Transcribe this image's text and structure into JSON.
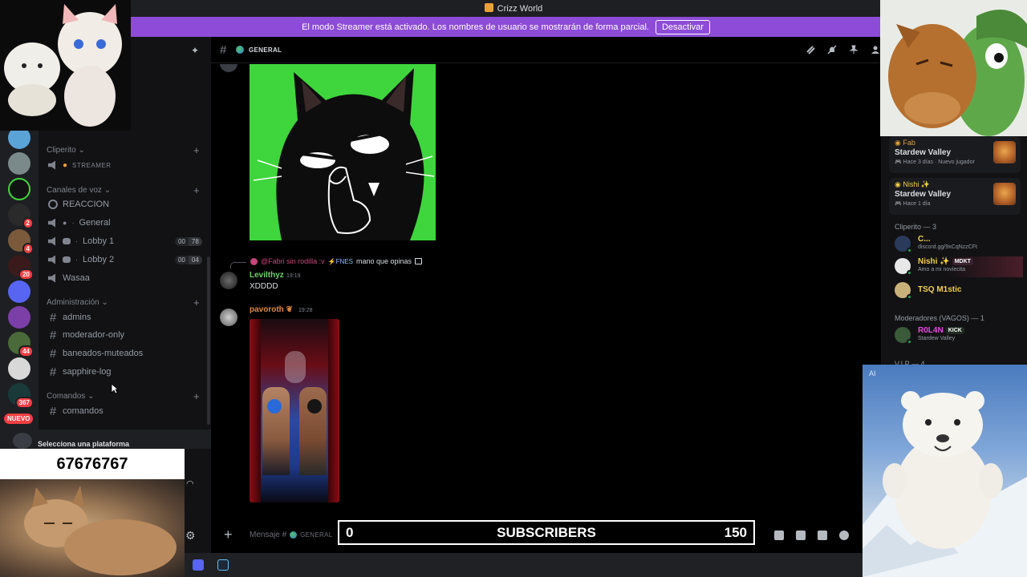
{
  "window": {
    "title": "Crizz World"
  },
  "banner": {
    "text": "El modo Streamer está activado. Los nombres de usuario se mostrarán de forma parcial.",
    "button": "Desactivar"
  },
  "guilds": {
    "badges": [
      "2",
      "4",
      "20",
      "44",
      "367"
    ],
    "new_label": "NUEVO"
  },
  "sidebar": {
    "categories": {
      "cliperito": "Cliperito",
      "voz": "Canales de voz",
      "admin": "Administración",
      "comandos": "Comandos"
    },
    "cliperito_channel": "STREAMER",
    "voice": [
      {
        "name": "REACCION"
      },
      {
        "name": "General"
      },
      {
        "name": "Lobby 1",
        "c1": "00",
        "c2": "78"
      },
      {
        "name": "Lobby 2",
        "c1": "00",
        "c2": "04"
      },
      {
        "name": "Wasaa"
      }
    ],
    "admin": [
      "admins",
      "moderador-only",
      "baneados-muteados",
      "sapphire-log"
    ],
    "comandos": [
      "comandos"
    ],
    "user_panel": "Selecciona una plataforma"
  },
  "chat": {
    "channel_name": "GENERAL",
    "reply": {
      "name": "@Fabri sin rodilla :v",
      "tag": "FNES",
      "text": "mano que opinas"
    },
    "messages": [
      {
        "author": "Levilthyz",
        "time": "19:19",
        "content": "XDDDD"
      },
      {
        "author": "pavoroth",
        "time": "19:28"
      }
    ],
    "composer_placeholder": "Mensaje #",
    "composer_channel": "GENERAL"
  },
  "subscribers": {
    "current": "0",
    "label": "SUBSCRIBERS",
    "goal": "150"
  },
  "overlay": {
    "counter": "67676767",
    "ai_tag": "AI"
  },
  "members": {
    "activities": [
      {
        "name": "Fab",
        "game": "Stardew Valley",
        "meta1": "Hace 3 días",
        "meta2": "Nuevo jugador"
      },
      {
        "name": "Nishi ✨",
        "game": "Stardew Valley",
        "meta1": "Hace 1 día"
      }
    ],
    "cliperito_group": "Cliperito — 3",
    "cliperito_members": [
      {
        "name": "C...",
        "sub": "discord.gg/9xCqNzzCFt"
      },
      {
        "name": "Nishi ✨",
        "tag": "MDKT",
        "sub": "Amo a mi noviecita"
      },
      {
        "name": "TSQ M1stic"
      }
    ],
    "mod_group": "Moderadores (VAGOS) — 1",
    "mod_members": [
      {
        "name": "R0L4N",
        "tag": "KICK",
        "sub": "Stardew Valley"
      }
    ],
    "vip_group": "V.I.P — 4"
  },
  "colors": {
    "banner": "#8d4bd8",
    "accent": "#5865f2",
    "green": "#3ed63c"
  }
}
